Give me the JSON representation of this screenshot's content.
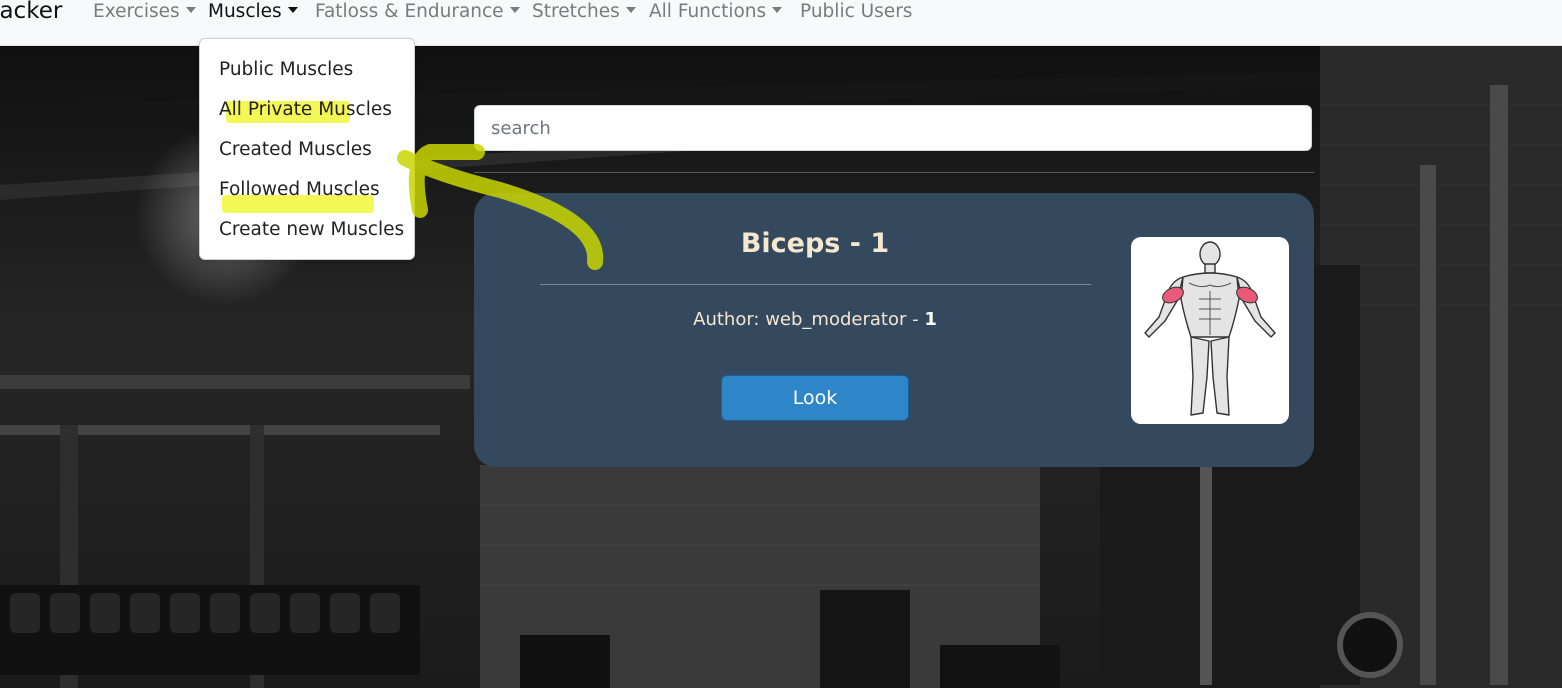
{
  "nav": {
    "brand": "racker",
    "items": [
      {
        "label": "Exercises"
      },
      {
        "label": "Muscles"
      },
      {
        "label": "Fatloss & Endurance"
      },
      {
        "label": "Stretches"
      },
      {
        "label": "All Functions"
      },
      {
        "label": "Public Users"
      }
    ]
  },
  "dropdown": {
    "items": [
      {
        "label": "Public Muscles"
      },
      {
        "label": "All Private Muscles"
      },
      {
        "label": "Created Muscles"
      },
      {
        "label": "Followed Muscles"
      },
      {
        "label": "Create new Muscles"
      }
    ]
  },
  "search": {
    "placeholder": "search",
    "value": ""
  },
  "card": {
    "title": "Biceps - 1",
    "author_prefix": "Author: web_moderator - ",
    "author_count": "1",
    "button_label": "Look",
    "image": "muscle-diagram-biceps"
  },
  "colors": {
    "navbar_bg": "#f8f9fa",
    "card_bg": "#34495e",
    "card_text": "#f6e7cf",
    "button_bg": "#2e86c9",
    "highlight": "#f0f51e",
    "muscle_highlight": "#e85a78"
  }
}
